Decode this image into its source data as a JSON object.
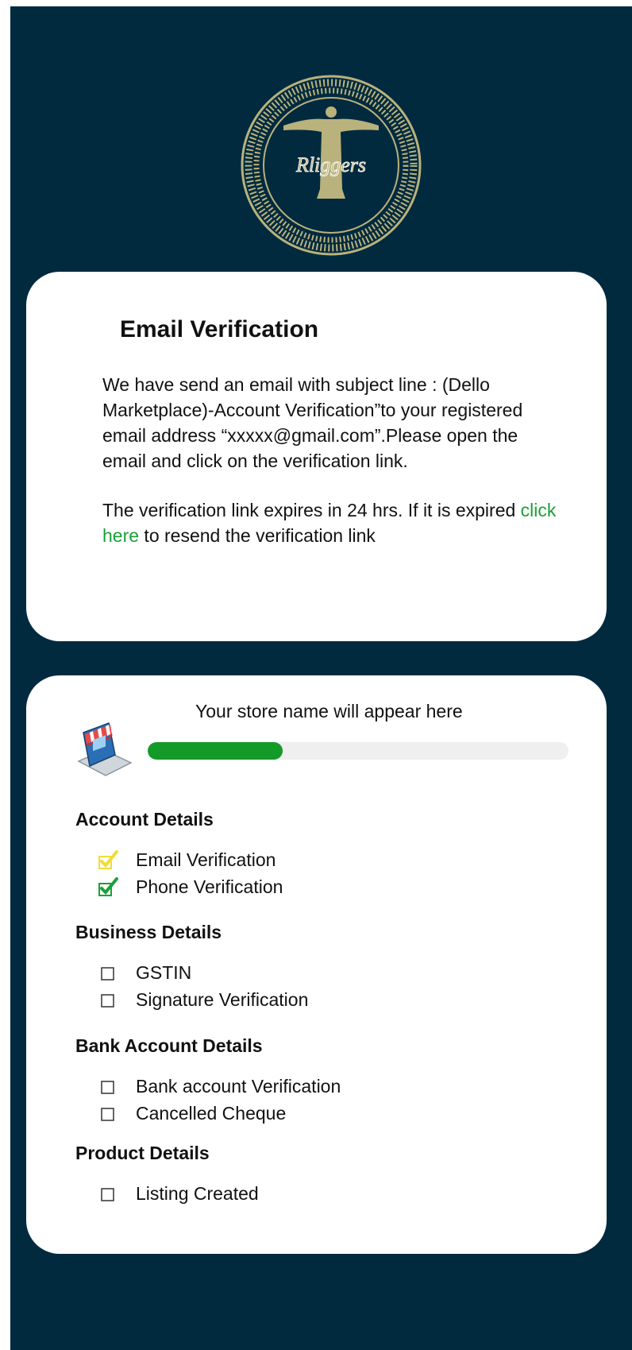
{
  "brand": {
    "logo_text": "Rliggers"
  },
  "email_card": {
    "title": "Email Verification",
    "paragraph_1": "We have send an email with subject line : (Dello Marketplace)-Account Verification”to your registered email address “xxxxx@gmail.com”.Please open the email and click on the verification link.",
    "paragraph_2_before": "The verification link expires in 24 hrs. If it is expired ",
    "paragraph_2_link": "click here",
    "paragraph_2_after": " to resend the verification link"
  },
  "progress_card": {
    "store_name": "Your store name will appear here",
    "progress_fraction": 0.32,
    "sections": [
      {
        "title": "Account Details",
        "items": [
          {
            "label": "Email Verification",
            "state": "checked",
            "color": "#f0dc3a"
          },
          {
            "label": "Phone Verification",
            "state": "checked",
            "color": "#1aa037"
          }
        ]
      },
      {
        "title": "Business Details",
        "items": [
          {
            "label": "GSTIN",
            "state": "unchecked"
          },
          {
            "label": "Signature Verification",
            "state": "unchecked"
          }
        ]
      },
      {
        "title": "Bank Account Details",
        "items": [
          {
            "label": "Bank account Verification",
            "state": "unchecked"
          },
          {
            "label": "Cancelled Cheque",
            "state": "unchecked"
          }
        ]
      },
      {
        "title": "Product Details",
        "items": [
          {
            "label": "Listing Created",
            "state": "unchecked"
          }
        ]
      }
    ]
  },
  "colors": {
    "background": "#012a3f",
    "card": "#ffffff",
    "logo_gold": "#b9b27c",
    "link_green": "#1aa037",
    "progress_green": "#149a27",
    "track_gray": "#efefef"
  },
  "icons": {
    "logo": "christ-redeemer-wreath-logo",
    "store": "online-store-laptop-icon"
  }
}
